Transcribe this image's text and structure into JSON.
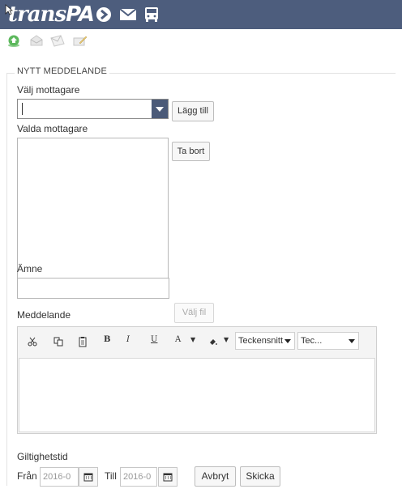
{
  "header": {
    "logo_main": "trans",
    "logo_suffix": "PA",
    "icons": [
      "arrow-right-circle-icon",
      "envelope-icon",
      "bus-icon"
    ]
  },
  "toolbar": {
    "icons": [
      "home-icon",
      "inbox-icon",
      "sent-mail-icon",
      "compose-icon"
    ]
  },
  "form": {
    "legend": "NYTT MEDDELANDE",
    "recipient_select_label": "Välj mottagare",
    "recipient_select_value": "",
    "add_button": "Lägg till",
    "selected_recipients_label": "Valda mottagare",
    "selected_recipients": [],
    "remove_button": "Ta bort",
    "subject_label": "Ämne",
    "subject_value": "",
    "message_label": "Meddelande",
    "choose_file_button": "Välj fil",
    "editor": {
      "tools": [
        "cut-icon",
        "copy-icon",
        "paste-icon",
        "bold-icon",
        "italic-icon",
        "underline-icon",
        "font-color-icon",
        "highlight-icon"
      ],
      "bold": "B",
      "italic": "I",
      "underline": "U",
      "font_color": "A",
      "font_family": "Teckensnitt",
      "font_size": "Tec...",
      "body": ""
    },
    "validity_label": "Giltighetstid",
    "from_label": "Från",
    "from_value": "2016-0",
    "to_label": "Till",
    "to_value": "2016-0",
    "cancel_button": "Avbryt",
    "send_button": "Skicka"
  },
  "colors": {
    "header_bg": "#4d5d7d",
    "select_caret_bg": "#4b5a78",
    "home_icon": "#5cb85c"
  }
}
